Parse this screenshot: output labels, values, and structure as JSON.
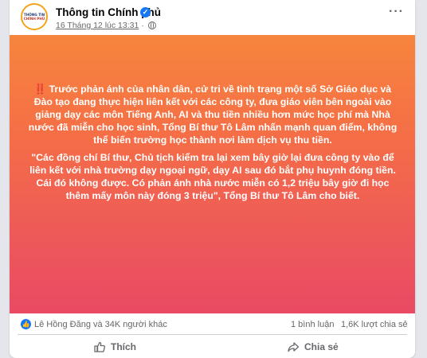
{
  "post": {
    "page_name": "Thông tin Chính phủ",
    "avatar_line1": "THÔNG TIN",
    "avatar_line2": "CHÍNH PHỦ",
    "timestamp": "16 Tháng 12 lúc 13:31",
    "separator": "·",
    "more_label": "···",
    "paragraph1": "Trước phản ánh của nhân dân, cử tri về tình trạng một số Sở Giáo dục và Đào tạo đang thực hiện liên kết với các công ty, đưa giáo viên bên ngoài vào giảng dạy các môn Tiếng Anh, AI và thu tiền nhiều hơn mức học phí mà Nhà nước đã miễn cho học sinh, Tổng Bí thư Tô Lâm nhấn mạnh quan điểm, không thể biến trường học thành nơi làm dịch vụ thu tiền.",
    "alert_glyph": "‼️",
    "paragraph2": "\"Các đồng chí Bí thư, Chủ tịch kiểm tra lại xem bây giờ lại đưa công ty vào để liên kết với nhà trường dạy ngoại ngữ, dạy AI sau đó bắt phụ huynh đóng tiền. Cái đó không được. Có phản ánh nhà nước miễn có 1,2 triệu bây giờ đi học thêm mấy môn này đóng 3 triệu\", Tổng Bí thư Tô Lâm cho biết."
  },
  "stats": {
    "reactors": "Lê Hồng Đăng và 34K người khác",
    "comments": "1 bình luận",
    "shares": "1,6K lượt chia sẻ"
  },
  "actions": {
    "like_label": "Thích",
    "share_label": "Chia sẻ"
  },
  "colors": {
    "accent": "#1877f2",
    "gradient_top": "#f7853d",
    "gradient_bottom": "#e94a64"
  }
}
